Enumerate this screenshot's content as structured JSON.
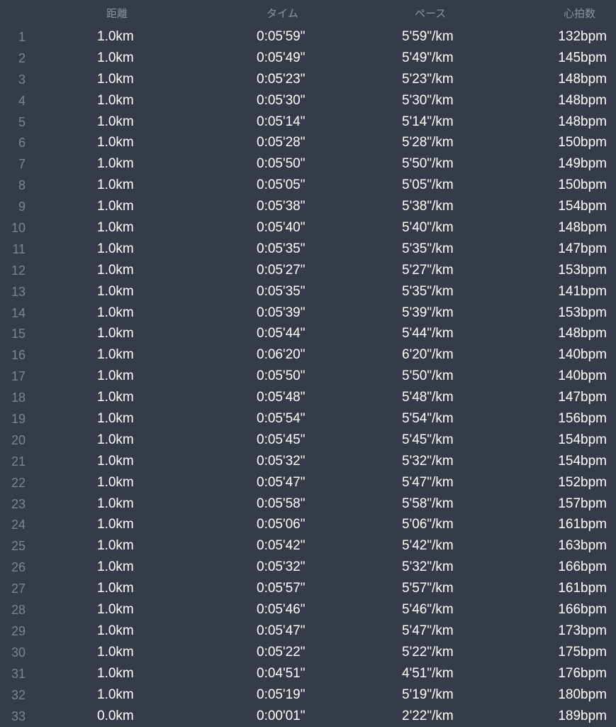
{
  "header": {
    "distance": "距離",
    "time": "タイム",
    "pace": "ペース",
    "heart_rate": "心拍数"
  },
  "rows": [
    {
      "idx": "1",
      "distance": "1.0km",
      "time": "0:05'59\"",
      "pace": "5'59\"/km",
      "hr": "132bpm"
    },
    {
      "idx": "2",
      "distance": "1.0km",
      "time": "0:05'49\"",
      "pace": "5'49\"/km",
      "hr": "145bpm"
    },
    {
      "idx": "3",
      "distance": "1.0km",
      "time": "0:05'23\"",
      "pace": "5'23\"/km",
      "hr": "148bpm"
    },
    {
      "idx": "4",
      "distance": "1.0km",
      "time": "0:05'30\"",
      "pace": "5'30\"/km",
      "hr": "148bpm"
    },
    {
      "idx": "5",
      "distance": "1.0km",
      "time": "0:05'14\"",
      "pace": "5'14\"/km",
      "hr": "148bpm"
    },
    {
      "idx": "6",
      "distance": "1.0km",
      "time": "0:05'28\"",
      "pace": "5'28\"/km",
      "hr": "150bpm"
    },
    {
      "idx": "7",
      "distance": "1.0km",
      "time": "0:05'50\"",
      "pace": "5'50\"/km",
      "hr": "149bpm"
    },
    {
      "idx": "8",
      "distance": "1.0km",
      "time": "0:05'05\"",
      "pace": "5'05\"/km",
      "hr": "150bpm"
    },
    {
      "idx": "9",
      "distance": "1.0km",
      "time": "0:05'38\"",
      "pace": "5'38\"/km",
      "hr": "154bpm"
    },
    {
      "idx": "10",
      "distance": "1.0km",
      "time": "0:05'40\"",
      "pace": "5'40\"/km",
      "hr": "148bpm"
    },
    {
      "idx": "11",
      "distance": "1.0km",
      "time": "0:05'35\"",
      "pace": "5'35\"/km",
      "hr": "147bpm"
    },
    {
      "idx": "12",
      "distance": "1.0km",
      "time": "0:05'27\"",
      "pace": "5'27\"/km",
      "hr": "153bpm"
    },
    {
      "idx": "13",
      "distance": "1.0km",
      "time": "0:05'35\"",
      "pace": "5'35\"/km",
      "hr": "141bpm"
    },
    {
      "idx": "14",
      "distance": "1.0km",
      "time": "0:05'39\"",
      "pace": "5'39\"/km",
      "hr": "153bpm"
    },
    {
      "idx": "15",
      "distance": "1.0km",
      "time": "0:05'44\"",
      "pace": "5'44\"/km",
      "hr": "148bpm"
    },
    {
      "idx": "16",
      "distance": "1.0km",
      "time": "0:06'20\"",
      "pace": "6'20\"/km",
      "hr": "140bpm"
    },
    {
      "idx": "17",
      "distance": "1.0km",
      "time": "0:05'50\"",
      "pace": "5'50\"/km",
      "hr": "140bpm"
    },
    {
      "idx": "18",
      "distance": "1.0km",
      "time": "0:05'48\"",
      "pace": "5'48\"/km",
      "hr": "147bpm"
    },
    {
      "idx": "19",
      "distance": "1.0km",
      "time": "0:05'54\"",
      "pace": "5'54\"/km",
      "hr": "156bpm"
    },
    {
      "idx": "20",
      "distance": "1.0km",
      "time": "0:05'45\"",
      "pace": "5'45\"/km",
      "hr": "154bpm"
    },
    {
      "idx": "21",
      "distance": "1.0km",
      "time": "0:05'32\"",
      "pace": "5'32\"/km",
      "hr": "154bpm"
    },
    {
      "idx": "22",
      "distance": "1.0km",
      "time": "0:05'47\"",
      "pace": "5'47\"/km",
      "hr": "152bpm"
    },
    {
      "idx": "23",
      "distance": "1.0km",
      "time": "0:05'58\"",
      "pace": "5'58\"/km",
      "hr": "157bpm"
    },
    {
      "idx": "24",
      "distance": "1.0km",
      "time": "0:05'06\"",
      "pace": "5'06\"/km",
      "hr": "161bpm"
    },
    {
      "idx": "25",
      "distance": "1.0km",
      "time": "0:05'42\"",
      "pace": "5'42\"/km",
      "hr": "163bpm"
    },
    {
      "idx": "26",
      "distance": "1.0km",
      "time": "0:05'32\"",
      "pace": "5'32\"/km",
      "hr": "166bpm"
    },
    {
      "idx": "27",
      "distance": "1.0km",
      "time": "0:05'57\"",
      "pace": "5'57\"/km",
      "hr": "161bpm"
    },
    {
      "idx": "28",
      "distance": "1.0km",
      "time": "0:05'46\"",
      "pace": "5'46\"/km",
      "hr": "166bpm"
    },
    {
      "idx": "29",
      "distance": "1.0km",
      "time": "0:05'47\"",
      "pace": "5'47\"/km",
      "hr": "173bpm"
    },
    {
      "idx": "30",
      "distance": "1.0km",
      "time": "0:05'22\"",
      "pace": "5'22\"/km",
      "hr": "175bpm"
    },
    {
      "idx": "31",
      "distance": "1.0km",
      "time": "0:04'51\"",
      "pace": "4'51\"/km",
      "hr": "176bpm"
    },
    {
      "idx": "32",
      "distance": "1.0km",
      "time": "0:05'19\"",
      "pace": "5'19\"/km",
      "hr": "180bpm"
    },
    {
      "idx": "33",
      "distance": "0.0km",
      "time": "0:00'01\"",
      "pace": "2'22\"/km",
      "hr": "189bpm"
    }
  ],
  "colors": {
    "background": "#363b4a",
    "header_text": "#8d93a3",
    "index_text": "#7d8394",
    "value_text": "#ffffff"
  }
}
